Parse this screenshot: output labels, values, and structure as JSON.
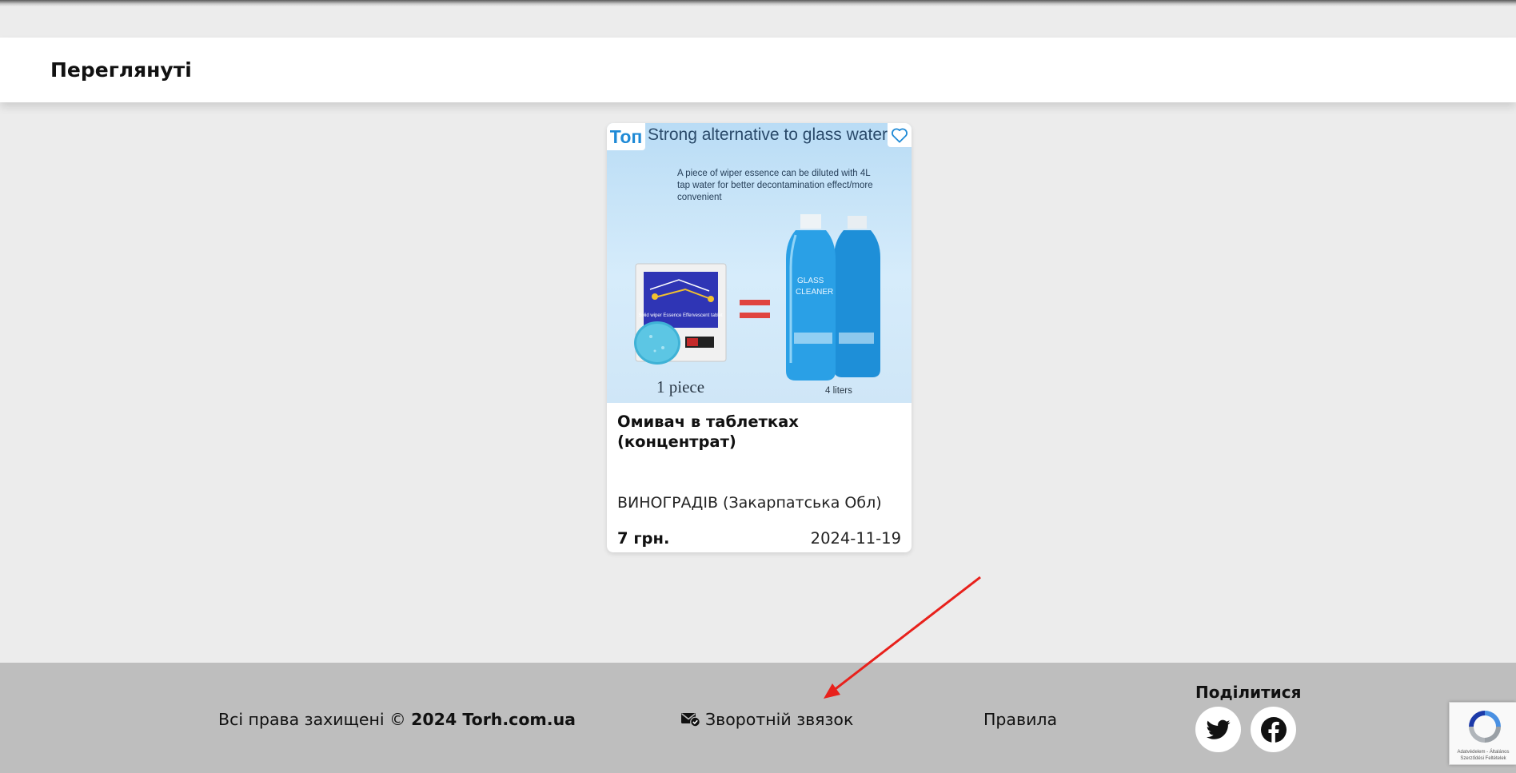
{
  "viewed_section": {
    "title": "Переглянуті"
  },
  "product_card": {
    "badge": "Топ",
    "image": {
      "headline": "Strong alternative to glass water",
      "subtext": "A piece of wiper essence can be diluted with 4L tap water for better decontamination effect/more convenient",
      "packet_label": "Solid wiper Essence Effervescent tablet",
      "bottle_label": "GLASS CLEANER",
      "caption_left": "1 piece",
      "caption_right": "4 liters"
    },
    "title": "Омивач в таблетках (концентрат)",
    "location": "ВИНОГРАДІВ (Закарпатська Обл)",
    "price": "7 грн.",
    "date": "2024-11-19"
  },
  "footer": {
    "copyright_prefix": "Всі права захищені © ",
    "copyright_bold": "2024 Torh.com.ua",
    "feedback_label": "Зворотній звязок",
    "rules_label": "Правила",
    "share_title": "Поділитися",
    "social": [
      "twitter-icon",
      "facebook-icon"
    ]
  },
  "recaptcha": {
    "text": "Adatvédelem - Általános Szerződési Feltételek"
  },
  "colors": {
    "page_bg": "#ececec",
    "footer_bg": "#bebebe",
    "badge_blue": "#1f8ad6",
    "arrow_red": "#e8211c"
  }
}
